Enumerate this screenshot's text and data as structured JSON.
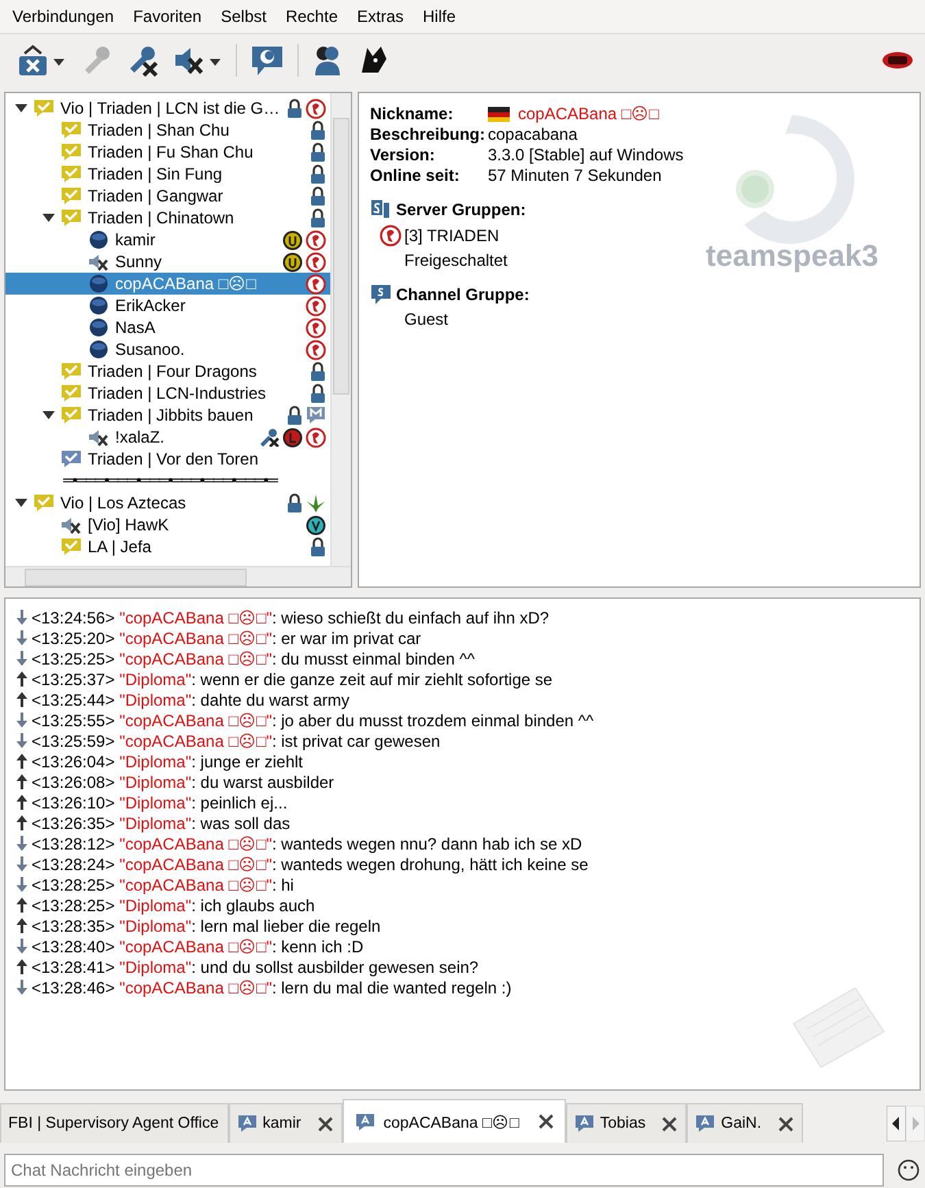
{
  "menu": [
    "Verbindungen",
    "Favoriten",
    "Selbst",
    "Rechte",
    "Extras",
    "Hilfe"
  ],
  "tree": [
    {
      "kind": "channel",
      "name": "Vio | Triaden | LCN ist die G…",
      "color": "#d8c020",
      "expanded": true,
      "selected": false,
      "badges": [
        {
          "kind": "lock"
        },
        {
          "kind": "triaden"
        }
      ],
      "children": [
        {
          "kind": "channel",
          "name": "Triaden | Shan Chu",
          "color": "#d8c020",
          "selected": false,
          "badges": [
            {
              "kind": "lock"
            }
          ]
        },
        {
          "kind": "channel",
          "name": "Triaden | Fu Shan Chu",
          "color": "#d8c020",
          "selected": false,
          "badges": [
            {
              "kind": "lock"
            }
          ]
        },
        {
          "kind": "channel",
          "name": "Triaden | Sin Fung",
          "color": "#d8c020",
          "selected": false,
          "badges": [
            {
              "kind": "lock"
            }
          ]
        },
        {
          "kind": "channel",
          "name": "Triaden | Gangwar",
          "color": "#d8c020",
          "selected": false,
          "badges": [
            {
              "kind": "lock"
            }
          ]
        },
        {
          "kind": "channel",
          "name": "Triaden | Chinatown",
          "color": "#d8c020",
          "expanded": true,
          "selected": false,
          "badges": [
            {
              "kind": "lock"
            }
          ],
          "children": [
            {
              "kind": "user",
              "name": "kamir",
              "muted": false,
              "selected": false,
              "badges": [
                {
                  "kind": "u"
                },
                {
                  "kind": "triaden"
                }
              ]
            },
            {
              "kind": "user",
              "name": "Sunny",
              "muted": true,
              "selected": false,
              "badges": [
                {
                  "kind": "u"
                },
                {
                  "kind": "triaden"
                }
              ]
            },
            {
              "kind": "user",
              "name": "copACABana □☹□",
              "muted": false,
              "selected": true,
              "badges": [
                {
                  "kind": "triaden"
                }
              ]
            },
            {
              "kind": "user",
              "name": "ErikAcker",
              "muted": false,
              "selected": false,
              "badges": [
                {
                  "kind": "triaden"
                }
              ]
            },
            {
              "kind": "user",
              "name": "NasA",
              "muted": false,
              "selected": false,
              "badges": [
                {
                  "kind": "triaden"
                }
              ]
            },
            {
              "kind": "user",
              "name": "Susanoo.",
              "muted": false,
              "selected": false,
              "badges": [
                {
                  "kind": "triaden"
                }
              ]
            }
          ]
        },
        {
          "kind": "channel",
          "name": "Triaden | Four Dragons",
          "color": "#d8c020",
          "selected": false,
          "badges": [
            {
              "kind": "lock"
            }
          ]
        },
        {
          "kind": "channel",
          "name": "Triaden | LCN-Industries",
          "color": "#d8c020",
          "selected": false,
          "badges": [
            {
              "kind": "lock"
            }
          ]
        },
        {
          "kind": "channel",
          "name": "Triaden | Jibbits bauen",
          "color": "#d8c020",
          "expanded": true,
          "selected": false,
          "badges": [
            {
              "kind": "lock"
            },
            {
              "kind": "moderated"
            }
          ],
          "children": [
            {
              "kind": "user",
              "name": "!xalaZ.",
              "muted": true,
              "selected": false,
              "badges": [
                {
                  "kind": "mic_muted"
                },
                {
                  "kind": "l"
                },
                {
                  "kind": "triaden"
                }
              ]
            }
          ]
        },
        {
          "kind": "channel",
          "name": "Triaden | Vor den Toren",
          "color": "#6a88b8",
          "selected": false
        }
      ]
    },
    {
      "kind": "spacer",
      "name": "═•═══•═══•═══•═══•═══•═══•═",
      "selected": false
    },
    {
      "kind": "channel",
      "name": "Vio | Los Aztecas",
      "color": "#d8c020",
      "expanded": true,
      "selected": false,
      "badges": [
        {
          "kind": "lock"
        },
        {
          "kind": "leaf"
        }
      ],
      "children": [
        {
          "kind": "user",
          "name": "[Vio] HawK",
          "muted": true,
          "selected": false,
          "badges": [
            {
              "kind": "v"
            }
          ]
        },
        {
          "kind": "channel",
          "name": "LA | Jefa",
          "color": "#d8c020",
          "selected": false,
          "badges": [
            {
              "kind": "lock"
            }
          ]
        }
      ]
    }
  ],
  "info": {
    "fields": [
      {
        "label": "Nickname:",
        "value": "copACABana □☹□",
        "kind": "nick"
      },
      {
        "label": "Beschreibung:",
        "value": "copacabana",
        "kind": "plain"
      },
      {
        "label": "Version:",
        "value": "3.3.0 [Stable] auf Windows",
        "kind": "plain"
      },
      {
        "label": "Online seit:",
        "value": "57 Minuten 7 Sekunden",
        "kind": "plain"
      }
    ],
    "server_groups_title": "Server Gruppen:",
    "server_groups": [
      "[3] TRIADEN",
      "Freigeschaltet"
    ],
    "channel_group_title": "Channel Gruppe:",
    "channel_group": "Guest",
    "logo_text": "teamspeak3"
  },
  "chat": [
    {
      "kind": "in",
      "time": "<13:24:56>",
      "sender": "\"copACABana □☹□\"",
      "text": ": wieso schießt du einfach auf ihn xD?"
    },
    {
      "kind": "in",
      "time": "<13:25:20>",
      "sender": "\"copACABana □☹□\"",
      "text": ": er war im privat car"
    },
    {
      "kind": "in",
      "time": "<13:25:25>",
      "sender": "\"copACABana □☹□\"",
      "text": ": du musst einmal binden ^^"
    },
    {
      "kind": "out",
      "time": "<13:25:37>",
      "sender": "\"Diploma\"",
      "text": ": wenn er die ganze zeit auf mir ziehlt sofortige se"
    },
    {
      "kind": "out",
      "time": "<13:25:44>",
      "sender": "\"Diploma\"",
      "text": ": dahte du warst army"
    },
    {
      "kind": "in",
      "time": "<13:25:55>",
      "sender": "\"copACABana □☹□\"",
      "text": ": jo aber du musst trozdem einmal binden ^^"
    },
    {
      "kind": "in",
      "time": "<13:25:59>",
      "sender": "\"copACABana □☹□\"",
      "text": ": ist privat car gewesen"
    },
    {
      "kind": "out",
      "time": "<13:26:04>",
      "sender": "\"Diploma\"",
      "text": ": junge er ziehlt"
    },
    {
      "kind": "out",
      "time": "<13:26:08>",
      "sender": "\"Diploma\"",
      "text": ": du warst ausbilder"
    },
    {
      "kind": "out",
      "time": "<13:26:10>",
      "sender": "\"Diploma\"",
      "text": ": peinlich ej..."
    },
    {
      "kind": "out",
      "time": "<13:26:35>",
      "sender": "\"Diploma\"",
      "text": ": was soll das"
    },
    {
      "kind": "in",
      "time": "<13:28:12>",
      "sender": "\"copACABana □☹□\"",
      "text": ": wanteds wegen nnu? dann hab ich se xD"
    },
    {
      "kind": "in",
      "time": "<13:28:24>",
      "sender": "\"copACABana □☹□\"",
      "text": ": wanteds wegen drohung, hätt ich keine se"
    },
    {
      "kind": "in",
      "time": "<13:28:25>",
      "sender": "\"copACABana □☹□\"",
      "text": ": hi"
    },
    {
      "kind": "out",
      "time": "<13:28:25>",
      "sender": "\"Diploma\"",
      "text": ": ich glaubs auch"
    },
    {
      "kind": "out",
      "time": "<13:28:35>",
      "sender": "\"Diploma\"",
      "text": ": lern mal lieber die regeln"
    },
    {
      "kind": "in",
      "time": "<13:28:40>",
      "sender": "\"copACABana □☹□\"",
      "text": ": kenn ich :D"
    },
    {
      "kind": "out",
      "time": "<13:28:41>",
      "sender": "\"Diploma\"",
      "text": ": und du sollst ausbilder gewesen sein?"
    },
    {
      "kind": "in",
      "time": "<13:28:46>",
      "sender": "\"copACABana □☹□\"",
      "text": ": lern du mal die wanted regeln :)"
    }
  ],
  "tabs": [
    {
      "label": "FBI | Supervisory Agent Office",
      "selected": false,
      "closable": false
    },
    {
      "label": "kamir",
      "selected": false,
      "closable": true
    },
    {
      "label": "copACABana □☹□",
      "selected": true,
      "closable": true
    },
    {
      "label": "Tobias",
      "selected": false,
      "closable": true
    },
    {
      "label": "GaiN.",
      "selected": false,
      "closable": true
    }
  ],
  "input": {
    "placeholder": "Chat Nachricht eingeben"
  }
}
